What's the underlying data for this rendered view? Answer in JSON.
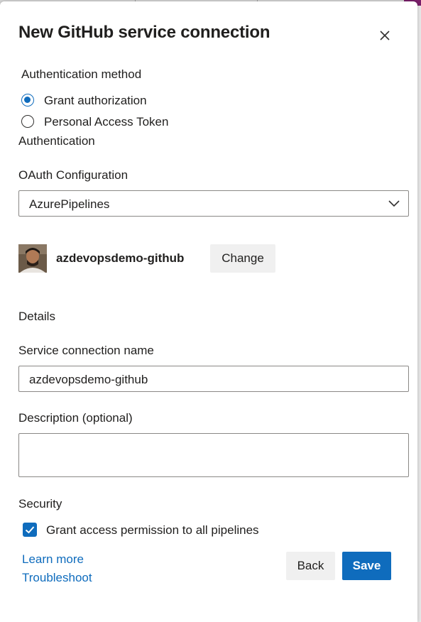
{
  "dialog": {
    "title": "New GitHub service connection"
  },
  "auth_method": {
    "label": "Authentication method",
    "options": [
      {
        "label": "Grant authorization",
        "selected": true
      },
      {
        "label": "Personal Access Token",
        "selected": false
      }
    ]
  },
  "authentication": {
    "label": "Authentication",
    "oauth_label": "OAuth Configuration",
    "oauth_value": "AzurePipelines",
    "github_user": "azdevopsdemo-github",
    "change_label": "Change"
  },
  "details": {
    "label": "Details",
    "name_label": "Service connection name",
    "name_value": "azdevopsdemo-github",
    "description_label": "Description (optional)",
    "description_value": ""
  },
  "security": {
    "label": "Security",
    "grant_access_label": "Grant access permission to all pipelines",
    "grant_access_checked": true
  },
  "footer": {
    "learn_more": "Learn more",
    "troubleshoot": "Troubleshoot",
    "back_label": "Back",
    "save_label": "Save"
  },
  "colors": {
    "accent": "#0f6cbd",
    "text": "#201f1e",
    "border": "#8a8886"
  }
}
